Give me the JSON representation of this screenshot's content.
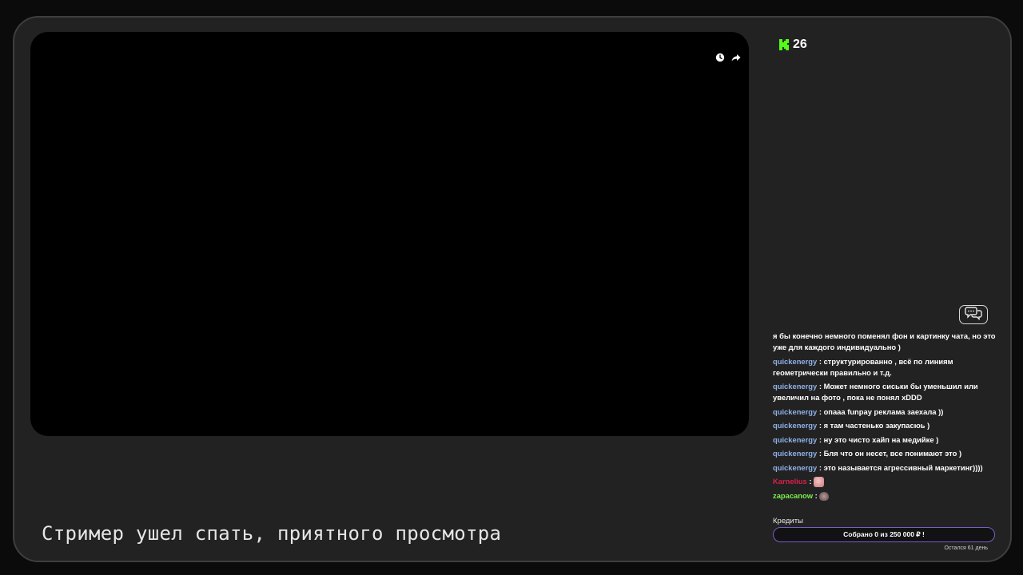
{
  "viewers": {
    "count": "26",
    "brand_color": "#53fc18"
  },
  "video": {
    "icons": [
      "clock-icon",
      "share-icon"
    ]
  },
  "offline_message": "Стример ушел спать, приятного просмотра",
  "chat": {
    "toggle_icon": "chat-bubbles-icon",
    "messages": [
      {
        "user": "",
        "text": "я бы конечно немного поменял фон и картинку чата, но это уже для каждого индивидуально )",
        "color": "#ffffff"
      },
      {
        "user": "quickenergy",
        "text": " : структурированно , всё по линиям геометрически правильно и т.д.",
        "color": "#8fb1e6"
      },
      {
        "user": "quickenergy",
        "text": " : Может немного сиськи бы уменьшил или увеличил на фото , пока не понял xDDD",
        "color": "#8fb1e6"
      },
      {
        "user": "quickenergy",
        "text": " : опааа funpay реклама заехала ))",
        "color": "#8fb1e6"
      },
      {
        "user": "quickenergy",
        "text": " : я там частенько закупасюь )",
        "color": "#8fb1e6"
      },
      {
        "user": "quickenergy",
        "text": " : ну это чисто хайп на медийке )",
        "color": "#8fb1e6"
      },
      {
        "user": "quickenergy",
        "text": " : Бля что он несет, все понимают это )",
        "color": "#8fb1e6"
      },
      {
        "user": "quickenergy",
        "text": " : это называется агрессивный маркетинг))))",
        "color": "#8fb1e6"
      },
      {
        "user": "Karnelius",
        "text": " : ",
        "color": "#d9204a",
        "emote": "pink-emote"
      },
      {
        "user": "zapacanow",
        "text": " : ",
        "color": "#7cf04a",
        "emote": "hand-emote"
      }
    ]
  },
  "credits": {
    "label": "Кредиты",
    "progress_text": "Собрано 0  из 250 000 ₽ !",
    "progress_fraction": 0,
    "days_left": "Остался 61 день",
    "accent": "#7a5dc7"
  }
}
